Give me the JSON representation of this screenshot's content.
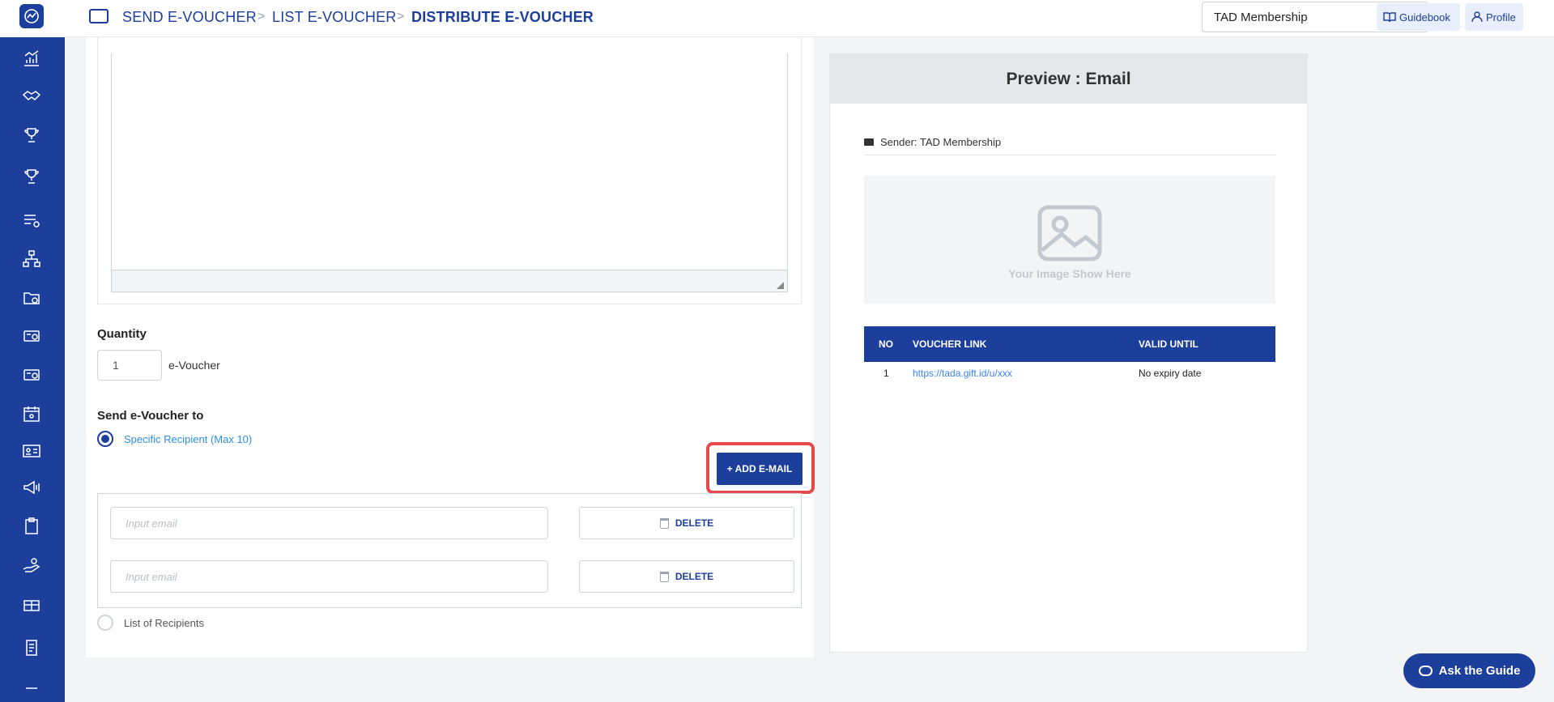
{
  "breadcrumb": {
    "items": [
      "SEND E-VOUCHER",
      "LIST E-VOUCHER",
      "DISTRIBUTE E-VOUCHER"
    ],
    "separator": ">"
  },
  "header": {
    "membership_select": "TAD Membership",
    "guidebook_label": "Guidebook",
    "profile_label": "Profile"
  },
  "sidebar": {
    "icons": [
      "dashboard-chart-icon",
      "handshake-icon",
      "trophy-icon",
      "trophy-icon",
      "list-settings-icon",
      "hierarchy-icon",
      "folder-icon",
      "voucher-card-icon",
      "voucher-card-icon",
      "calendar-icon",
      "id-card-icon",
      "megaphone-icon",
      "clipboard-icon",
      "hand-coins-icon",
      "gift-card-icon",
      "document-icon"
    ]
  },
  "form": {
    "quantity_label": "Quantity",
    "quantity_value": "1",
    "quantity_unit": "e-Voucher",
    "send_to_label": "Send e-Voucher to",
    "option_specific": "Specific Recipient (Max 10)",
    "option_list": "List of Recipients",
    "add_email_label": "+ ADD E-MAIL",
    "email_placeholder": "Input email",
    "delete_label": "DELETE"
  },
  "preview": {
    "title": "Preview : Email",
    "sender": "Sender: TAD Membership",
    "image_placeholder": "Your Image Show Here",
    "table": {
      "headers": [
        "NO",
        "VOUCHER LINK",
        "VALID UNTIL"
      ],
      "row": {
        "no": "1",
        "link": "https://tada.gift.id/u/xxx",
        "valid": "No expiry date"
      }
    }
  },
  "ask_guide_label": "Ask the Guide",
  "colors": {
    "primary": "#1d3f9c",
    "highlight": "#e5484d",
    "link": "#3b82f6"
  }
}
